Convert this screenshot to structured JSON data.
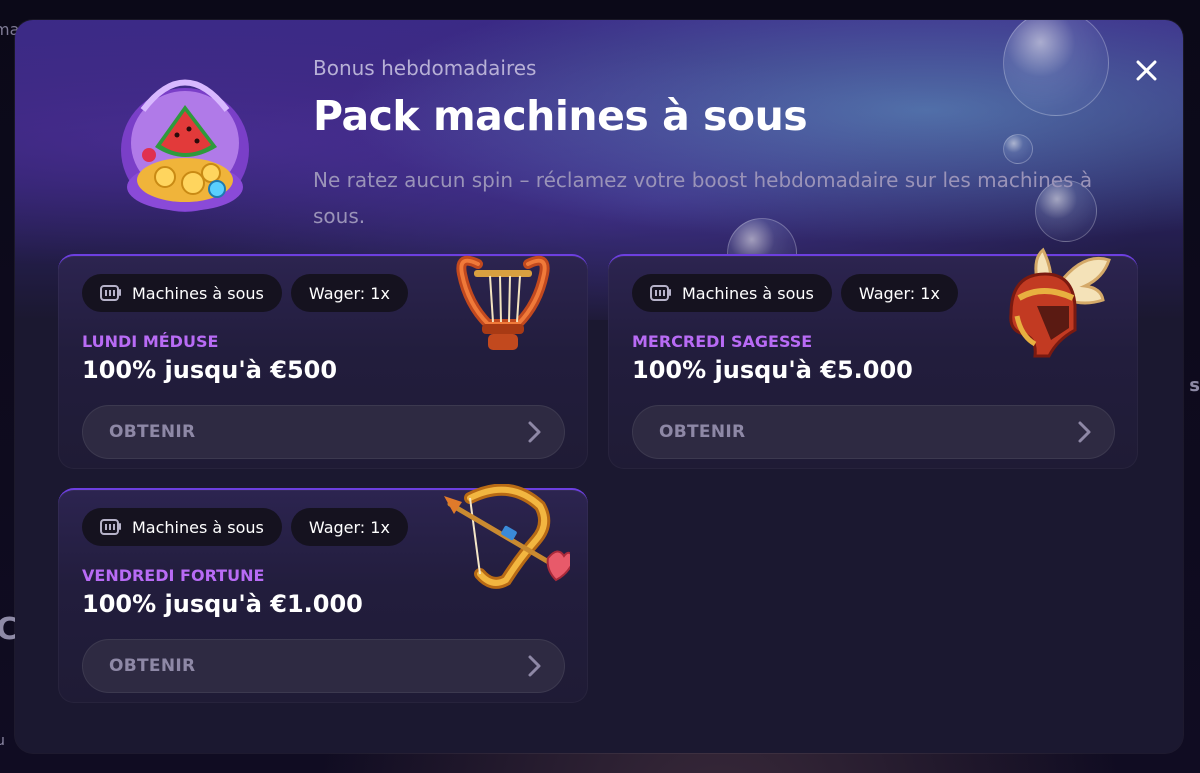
{
  "background": {
    "text_top_left": "ma",
    "text_mid_left": "C",
    "text_bottom_left": "u",
    "text_right": "s"
  },
  "modal": {
    "subtitle": "Bonus hebdomadaires",
    "title": "Pack machines à sous",
    "description": "Ne ratez aucun spin – réclamez votre boost hebdomadaire sur les machines à sous."
  },
  "cards": [
    {
      "category": "Machines à sous",
      "wager": "Wager: 1x",
      "day": "LUNDI MÉDUSE",
      "offer": "100% jusqu'à €500",
      "cta": "OBTENIR",
      "art_icon": "lyre-icon"
    },
    {
      "category": "Machines à sous",
      "wager": "Wager: 1x",
      "day": "MERCREDI SAGESSE",
      "offer": "100% jusqu'à €5.000",
      "cta": "OBTENIR",
      "art_icon": "winged-helmet-icon"
    },
    {
      "category": "Machines à sous",
      "wager": "Wager: 1x",
      "day": "VENDREDI FORTUNE",
      "offer": "100% jusqu'à €1.000",
      "cta": "OBTENIR",
      "art_icon": "bow-and-arrow-icon"
    }
  ],
  "colors": {
    "accent_purple": "#b86bf5",
    "card_border": "#6d3fe0",
    "modal_bg": "#1b1830"
  }
}
